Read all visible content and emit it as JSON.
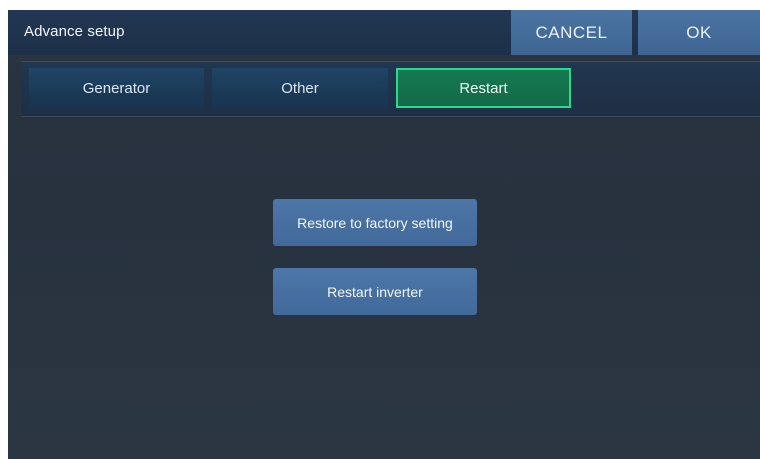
{
  "header": {
    "title": "Advance setup",
    "cancel_label": "CANCEL",
    "ok_label": "OK"
  },
  "tabs": [
    {
      "label": "Generator",
      "active": false
    },
    {
      "label": "Other",
      "active": false
    },
    {
      "label": "Restart",
      "active": true
    }
  ],
  "actions": {
    "restore_label": "Restore to factory setting",
    "restart_label": "Restart inverter"
  },
  "colors": {
    "background": "#2a3441",
    "header": "#223754",
    "button": "#4b74a3",
    "active_tab": "#157a52",
    "active_tab_border": "#2bd98a"
  }
}
